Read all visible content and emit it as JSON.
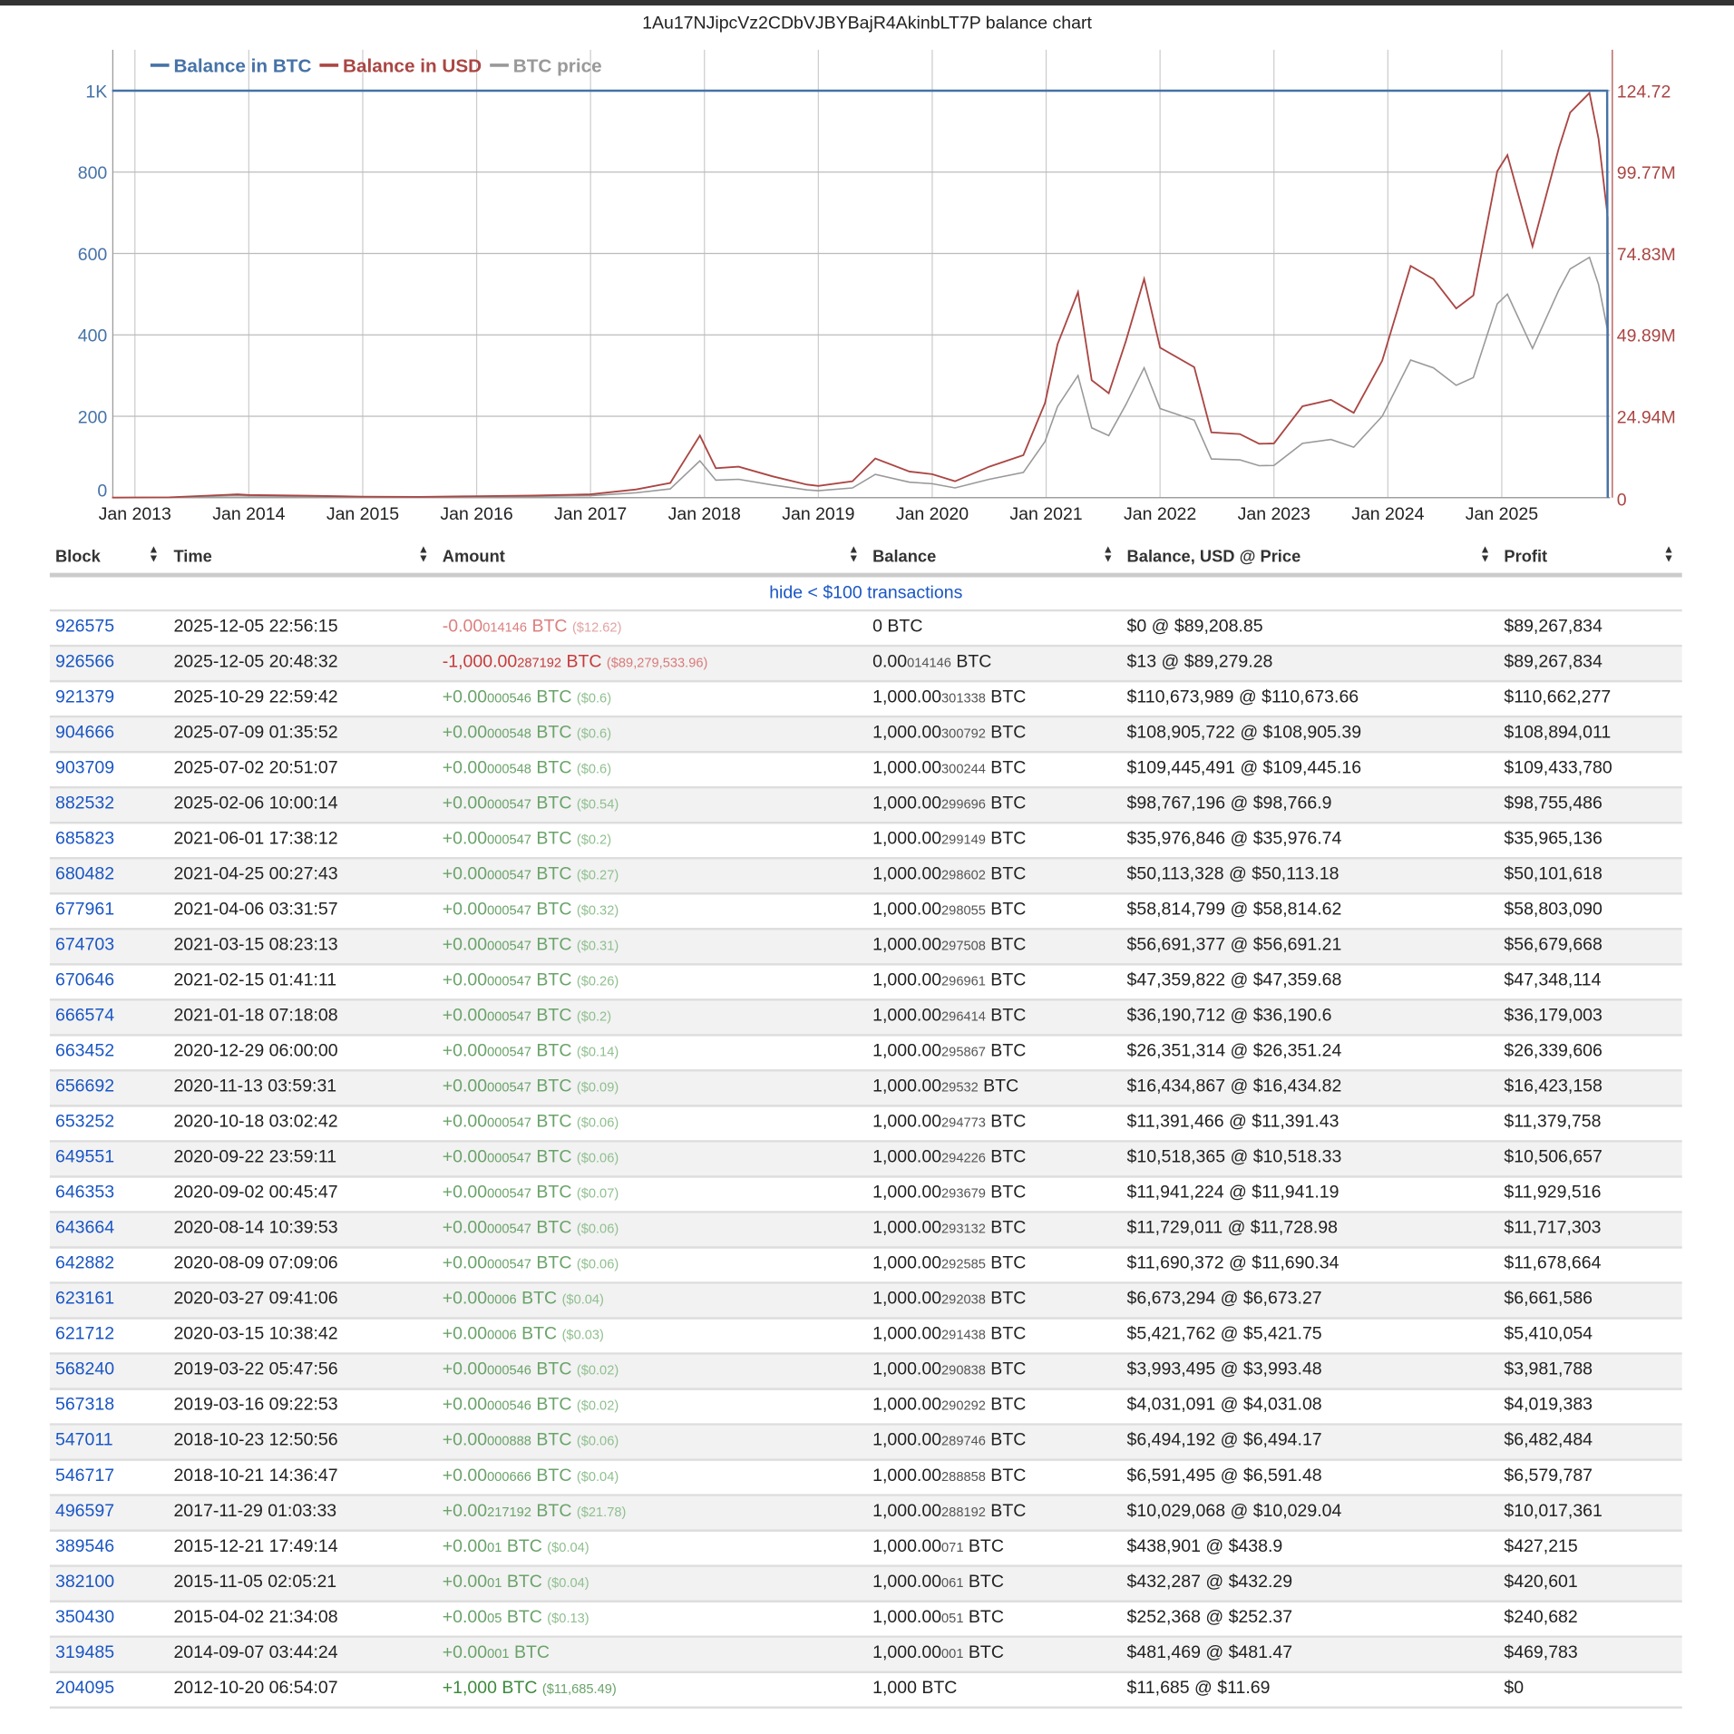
{
  "chart_title": "1Au17NJipcVz2CDbVJBYBajR4AkinbLT7P balance chart",
  "chart_data": {
    "type": "line",
    "title": "1Au17NJipcVz2CDbVJBYBajR4AkinbLT7P balance chart",
    "legend": [
      "Balance in BTC",
      "Balance in USD",
      "BTC price"
    ],
    "legend_position": "top-left",
    "colors": {
      "btc": "#4572a7",
      "usd": "#aa4643",
      "price": "#999999"
    },
    "left_axis": {
      "ticks": [
        "0",
        "200",
        "400",
        "600",
        "800",
        "1K"
      ],
      "range": [
        0,
        1000
      ]
    },
    "right_axis": {
      "ticks": [
        "0",
        "24.94M",
        "49.89M",
        "74.83M",
        "99.77M",
        "124.72"
      ],
      "range": [
        0,
        124720000
      ]
    },
    "x_ticks": [
      "Jan 2013",
      "Jan 2014",
      "Jan 2015",
      "Jan 2016",
      "Jan 2017",
      "Jan 2018",
      "Jan 2019",
      "Jan 2020",
      "Jan 2021",
      "Jan 2022",
      "Jan 2023",
      "Jan 2024",
      "Jan 2025"
    ],
    "x_range": [
      2012.8,
      2025.93
    ],
    "balance_btc": [
      [
        2012.8,
        1000
      ],
      [
        2025.925,
        1000
      ],
      [
        2025.93,
        0
      ]
    ],
    "btc_price": [
      [
        2012.8,
        11
      ],
      [
        2013.3,
        100
      ],
      [
        2013.9,
        1000
      ],
      [
        2014.0,
        800
      ],
      [
        2014.5,
        600
      ],
      [
        2015.0,
        300
      ],
      [
        2015.5,
        250
      ],
      [
        2016.0,
        430
      ],
      [
        2016.5,
        650
      ],
      [
        2017.0,
        1000
      ],
      [
        2017.4,
        2500
      ],
      [
        2017.7,
        4500
      ],
      [
        2017.96,
        19000
      ],
      [
        2018.1,
        9000
      ],
      [
        2018.3,
        9500
      ],
      [
        2018.6,
        6500
      ],
      [
        2018.9,
        4000
      ],
      [
        2019.0,
        3600
      ],
      [
        2019.3,
        5000
      ],
      [
        2019.5,
        12000
      ],
      [
        2019.8,
        8000
      ],
      [
        2020.0,
        7200
      ],
      [
        2020.2,
        5000
      ],
      [
        2020.5,
        9500
      ],
      [
        2020.8,
        13000
      ],
      [
        2020.99,
        29000
      ],
      [
        2021.1,
        47000
      ],
      [
        2021.28,
        63000
      ],
      [
        2021.4,
        36000
      ],
      [
        2021.55,
        32000
      ],
      [
        2021.7,
        48000
      ],
      [
        2021.86,
        67000
      ],
      [
        2022.0,
        46000
      ],
      [
        2022.3,
        40000
      ],
      [
        2022.45,
        20000
      ],
      [
        2022.7,
        19500
      ],
      [
        2022.87,
        16500
      ],
      [
        2023.0,
        16600
      ],
      [
        2023.25,
        28000
      ],
      [
        2023.5,
        30000
      ],
      [
        2023.7,
        26000
      ],
      [
        2023.95,
        42000
      ],
      [
        2024.2,
        71000
      ],
      [
        2024.4,
        67000
      ],
      [
        2024.6,
        58000
      ],
      [
        2024.75,
        62000
      ],
      [
        2024.96,
        100000
      ],
      [
        2025.05,
        105000
      ],
      [
        2025.27,
        77000
      ],
      [
        2025.5,
        107000
      ],
      [
        2025.6,
        118000
      ],
      [
        2025.77,
        124000
      ],
      [
        2025.85,
        110000
      ],
      [
        2025.93,
        86000
      ]
    ]
  },
  "table": {
    "headers": [
      "Block",
      "Time",
      "Amount",
      "Balance",
      "Balance, USD @ Price",
      "Profit"
    ],
    "filter_link": "hide < $100 transactions",
    "rows": [
      {
        "block": "926575",
        "time": "2025-12-05 22:56:15",
        "sign": "neg1",
        "amt": "-0.00",
        "amt_sm": "014146",
        "amt_usd": "($12.62)",
        "bal": "0",
        "bal_sm": "",
        "usd": "$0 @ $89,208.85",
        "profit": "$89,267,834"
      },
      {
        "block": "926566",
        "time": "2025-12-05 20:48:32",
        "sign": "neg",
        "amt": "-1,000.00",
        "amt_sm": "287192",
        "amt_usd": "($89,279,533.96)",
        "bal": "0.00",
        "bal_sm": "014146",
        "usd": "$13 @ $89,279.28",
        "profit": "$89,267,834"
      },
      {
        "block": "921379",
        "time": "2025-10-29 22:59:42",
        "sign": "pos",
        "amt": "+0.00",
        "amt_sm": "000546",
        "amt_usd": "($0.6)",
        "bal": "1,000.00",
        "bal_sm": "301338",
        "usd": "$110,673,989 @ $110,673.66",
        "profit": "$110,662,277"
      },
      {
        "block": "904666",
        "time": "2025-07-09 01:35:52",
        "sign": "pos",
        "amt": "+0.00",
        "amt_sm": "000548",
        "amt_usd": "($0.6)",
        "bal": "1,000.00",
        "bal_sm": "300792",
        "usd": "$108,905,722 @ $108,905.39",
        "profit": "$108,894,011"
      },
      {
        "block": "903709",
        "time": "2025-07-02 20:51:07",
        "sign": "pos",
        "amt": "+0.00",
        "amt_sm": "000548",
        "amt_usd": "($0.6)",
        "bal": "1,000.00",
        "bal_sm": "300244",
        "usd": "$109,445,491 @ $109,445.16",
        "profit": "$109,433,780"
      },
      {
        "block": "882532",
        "time": "2025-02-06 10:00:14",
        "sign": "pos",
        "amt": "+0.00",
        "amt_sm": "000547",
        "amt_usd": "($0.54)",
        "bal": "1,000.00",
        "bal_sm": "299696",
        "usd": "$98,767,196 @ $98,766.9",
        "profit": "$98,755,486"
      },
      {
        "block": "685823",
        "time": "2021-06-01 17:38:12",
        "sign": "pos",
        "amt": "+0.00",
        "amt_sm": "000547",
        "amt_usd": "($0.2)",
        "bal": "1,000.00",
        "bal_sm": "299149",
        "usd": "$35,976,846 @ $35,976.74",
        "profit": "$35,965,136"
      },
      {
        "block": "680482",
        "time": "2021-04-25 00:27:43",
        "sign": "pos",
        "amt": "+0.00",
        "amt_sm": "000547",
        "amt_usd": "($0.27)",
        "bal": "1,000.00",
        "bal_sm": "298602",
        "usd": "$50,113,328 @ $50,113.18",
        "profit": "$50,101,618"
      },
      {
        "block": "677961",
        "time": "2021-04-06 03:31:57",
        "sign": "pos",
        "amt": "+0.00",
        "amt_sm": "000547",
        "amt_usd": "($0.32)",
        "bal": "1,000.00",
        "bal_sm": "298055",
        "usd": "$58,814,799 @ $58,814.62",
        "profit": "$58,803,090"
      },
      {
        "block": "674703",
        "time": "2021-03-15 08:23:13",
        "sign": "pos",
        "amt": "+0.00",
        "amt_sm": "000547",
        "amt_usd": "($0.31)",
        "bal": "1,000.00",
        "bal_sm": "297508",
        "usd": "$56,691,377 @ $56,691.21",
        "profit": "$56,679,668"
      },
      {
        "block": "670646",
        "time": "2021-02-15 01:41:11",
        "sign": "pos",
        "amt": "+0.00",
        "amt_sm": "000547",
        "amt_usd": "($0.26)",
        "bal": "1,000.00",
        "bal_sm": "296961",
        "usd": "$47,359,822 @ $47,359.68",
        "profit": "$47,348,114"
      },
      {
        "block": "666574",
        "time": "2021-01-18 07:18:08",
        "sign": "pos",
        "amt": "+0.00",
        "amt_sm": "000547",
        "amt_usd": "($0.2)",
        "bal": "1,000.00",
        "bal_sm": "296414",
        "usd": "$36,190,712 @ $36,190.6",
        "profit": "$36,179,003"
      },
      {
        "block": "663452",
        "time": "2020-12-29 06:00:00",
        "sign": "pos",
        "amt": "+0.00",
        "amt_sm": "000547",
        "amt_usd": "($0.14)",
        "bal": "1,000.00",
        "bal_sm": "295867",
        "usd": "$26,351,314 @ $26,351.24",
        "profit": "$26,339,606"
      },
      {
        "block": "656692",
        "time": "2020-11-13 03:59:31",
        "sign": "pos",
        "amt": "+0.00",
        "amt_sm": "000547",
        "amt_usd": "($0.09)",
        "bal": "1,000.00",
        "bal_sm": "29532",
        "usd": "$16,434,867 @ $16,434.82",
        "profit": "$16,423,158"
      },
      {
        "block": "653252",
        "time": "2020-10-18 03:02:42",
        "sign": "pos",
        "amt": "+0.00",
        "amt_sm": "000547",
        "amt_usd": "($0.06)",
        "bal": "1,000.00",
        "bal_sm": "294773",
        "usd": "$11,391,466 @ $11,391.43",
        "profit": "$11,379,758"
      },
      {
        "block": "649551",
        "time": "2020-09-22 23:59:11",
        "sign": "pos",
        "amt": "+0.00",
        "amt_sm": "000547",
        "amt_usd": "($0.06)",
        "bal": "1,000.00",
        "bal_sm": "294226",
        "usd": "$10,518,365 @ $10,518.33",
        "profit": "$10,506,657"
      },
      {
        "block": "646353",
        "time": "2020-09-02 00:45:47",
        "sign": "pos",
        "amt": "+0.00",
        "amt_sm": "000547",
        "amt_usd": "($0.07)",
        "bal": "1,000.00",
        "bal_sm": "293679",
        "usd": "$11,941,224 @ $11,941.19",
        "profit": "$11,929,516"
      },
      {
        "block": "643664",
        "time": "2020-08-14 10:39:53",
        "sign": "pos",
        "amt": "+0.00",
        "amt_sm": "000547",
        "amt_usd": "($0.06)",
        "bal": "1,000.00",
        "bal_sm": "293132",
        "usd": "$11,729,011 @ $11,728.98",
        "profit": "$11,717,303"
      },
      {
        "block": "642882",
        "time": "2020-08-09 07:09:06",
        "sign": "pos",
        "amt": "+0.00",
        "amt_sm": "000547",
        "amt_usd": "($0.06)",
        "bal": "1,000.00",
        "bal_sm": "292585",
        "usd": "$11,690,372 @ $11,690.34",
        "profit": "$11,678,664"
      },
      {
        "block": "623161",
        "time": "2020-03-27 09:41:06",
        "sign": "pos",
        "amt": "+0.00",
        "amt_sm": "0006",
        "amt_usd": "($0.04)",
        "bal": "1,000.00",
        "bal_sm": "292038",
        "usd": "$6,673,294 @ $6,673.27",
        "profit": "$6,661,586"
      },
      {
        "block": "621712",
        "time": "2020-03-15 10:38:42",
        "sign": "pos",
        "amt": "+0.00",
        "amt_sm": "0006",
        "amt_usd": "($0.03)",
        "bal": "1,000.00",
        "bal_sm": "291438",
        "usd": "$5,421,762 @ $5,421.75",
        "profit": "$5,410,054"
      },
      {
        "block": "568240",
        "time": "2019-03-22 05:47:56",
        "sign": "pos",
        "amt": "+0.00",
        "amt_sm": "000546",
        "amt_usd": "($0.02)",
        "bal": "1,000.00",
        "bal_sm": "290838",
        "usd": "$3,993,495 @ $3,993.48",
        "profit": "$3,981,788"
      },
      {
        "block": "567318",
        "time": "2019-03-16 09:22:53",
        "sign": "pos",
        "amt": "+0.00",
        "amt_sm": "000546",
        "amt_usd": "($0.02)",
        "bal": "1,000.00",
        "bal_sm": "290292",
        "usd": "$4,031,091 @ $4,031.08",
        "profit": "$4,019,383"
      },
      {
        "block": "547011",
        "time": "2018-10-23 12:50:56",
        "sign": "pos",
        "amt": "+0.00",
        "amt_sm": "000888",
        "amt_usd": "($0.06)",
        "bal": "1,000.00",
        "bal_sm": "289746",
        "usd": "$6,494,192 @ $6,494.17",
        "profit": "$6,482,484"
      },
      {
        "block": "546717",
        "time": "2018-10-21 14:36:47",
        "sign": "pos",
        "amt": "+0.00",
        "amt_sm": "000666",
        "amt_usd": "($0.04)",
        "bal": "1,000.00",
        "bal_sm": "288858",
        "usd": "$6,591,495 @ $6,591.48",
        "profit": "$6,579,787"
      },
      {
        "block": "496597",
        "time": "2017-11-29 01:03:33",
        "sign": "pos",
        "amt": "+0.00",
        "amt_sm": "217192",
        "amt_usd": "($21.78)",
        "bal": "1,000.00",
        "bal_sm": "288192",
        "usd": "$10,029,068 @ $10,029.04",
        "profit": "$10,017,361"
      },
      {
        "block": "389546",
        "time": "2015-12-21 17:49:14",
        "sign": "pos",
        "amt": "+0.00",
        "amt_sm": "01",
        "amt_usd": "($0.04)",
        "bal": "1,000.00",
        "bal_sm": "071",
        "usd": "$438,901 @ $438.9",
        "profit": "$427,215"
      },
      {
        "block": "382100",
        "time": "2015-11-05 02:05:21",
        "sign": "pos",
        "amt": "+0.00",
        "amt_sm": "01",
        "amt_usd": "($0.04)",
        "bal": "1,000.00",
        "bal_sm": "061",
        "usd": "$432,287 @ $432.29",
        "profit": "$420,601"
      },
      {
        "block": "350430",
        "time": "2015-04-02 21:34:08",
        "sign": "pos",
        "amt": "+0.00",
        "amt_sm": "05",
        "amt_usd": "($0.13)",
        "bal": "1,000.00",
        "bal_sm": "051",
        "usd": "$252,368 @ $252.37",
        "profit": "$240,682"
      },
      {
        "block": "319485",
        "time": "2014-09-07 03:44:24",
        "sign": "pos",
        "amt": "+0.00",
        "amt_sm": "001",
        "amt_usd": "",
        "bal": "1,000.00",
        "bal_sm": "001",
        "usd": "$481,469 @ $481.47",
        "profit": "$469,783"
      },
      {
        "block": "204095",
        "time": "2012-10-20 06:54:07",
        "sign": "big",
        "amt": "+1,000",
        "amt_sm": "",
        "amt_usd": "($11,685.49)",
        "bal": "1,000",
        "bal_sm": "",
        "usd": "$11,685 @ $11.69",
        "profit": "$0"
      }
    ],
    "unit": "BTC"
  }
}
